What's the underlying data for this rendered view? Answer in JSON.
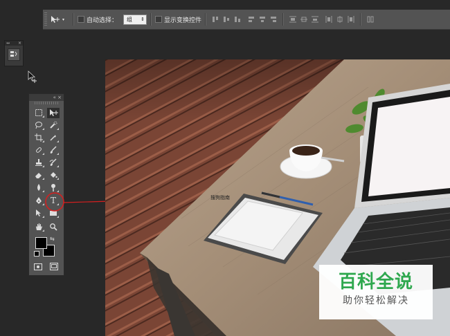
{
  "options_bar": {
    "auto_select_label": "自动选择：",
    "auto_select_value": "组",
    "show_transform_label": "显示变换控件"
  },
  "mini_panel": {
    "icon": "history-icon"
  },
  "toolbox": {
    "tools": [
      "marquee-icon",
      "move-icon",
      "lasso-icon",
      "quick-select-icon",
      "crop-icon",
      "eyedropper-icon",
      "healing-brush-icon",
      "brush-icon",
      "clone-stamp-icon",
      "history-brush-icon",
      "eraser-icon",
      "paint-bucket-icon",
      "blur-icon",
      "dodge-icon",
      "pen-icon",
      "type-icon",
      "path-select-icon",
      "rectangle-icon",
      "hand-icon",
      "zoom-icon"
    ],
    "active_tool": "type-icon",
    "type_tool_label": "T",
    "foreground_color": "#000000",
    "background_color": "#000000"
  },
  "annotation": {
    "label": "搜狗指南",
    "circle_color": "#d61f1f"
  },
  "watermark": {
    "title": "百科全说",
    "subtitle": "助你轻松解决",
    "title_color": "#2fa84f"
  }
}
